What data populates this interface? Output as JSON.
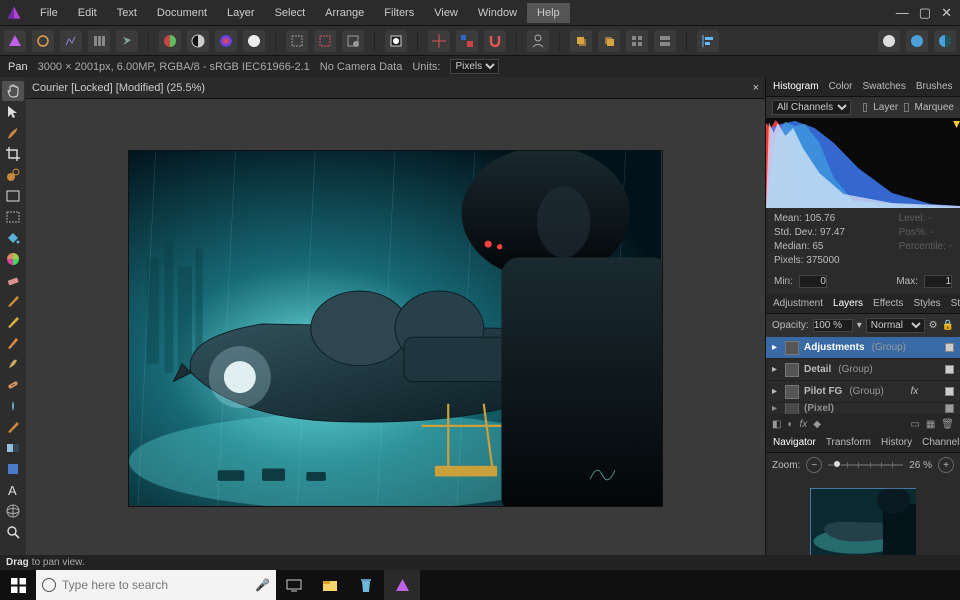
{
  "window": {
    "min": "—",
    "max": "▢",
    "close": "✕"
  },
  "menus": [
    "File",
    "Edit",
    "Text",
    "Document",
    "Layer",
    "Select",
    "Arrange",
    "Filters",
    "View",
    "Window",
    "Help"
  ],
  "menu_active": 10,
  "context": {
    "tool": "Pan",
    "docinfo": "3000 × 2001px, 6.00MP, RGBA/8 - sRGB IEC61966-2.1",
    "camera": "No Camera Data",
    "units_label": "Units:",
    "units_value": "Pixels"
  },
  "lefttools": [
    "hand-icon",
    "arrow-icon",
    "brush-icon",
    "crop-icon",
    "clone-icon",
    "marquee-icon",
    "dotted-marquee-icon",
    "flood-icon",
    "color-wheel-icon",
    "eraser-icon",
    "paintbrush-icon",
    "liquify-icon",
    "pencil-icon",
    "smudge-icon",
    "healing-icon",
    "dodge-icon",
    "paint-bucket-icon",
    "gradient-icon",
    "shape-icon",
    "text-a-icon",
    "mesh-icon",
    "zoom-icon"
  ],
  "doctab": {
    "title": "Courier [Locked] [Modified] (25.5%)",
    "close": "×"
  },
  "hist_tabs": [
    "Histogram",
    "Color",
    "Swatches",
    "Brushes"
  ],
  "hist_active": 0,
  "hist": {
    "channels": "All Channels",
    "layer_label": "Layer",
    "marquee_label": "Marquee",
    "mean_label": "Mean:",
    "mean": "105.76",
    "std_label": "Std. Dev.:",
    "std": "97.47",
    "median_label": "Median:",
    "median": "65",
    "pixels_label": "Pixels:",
    "pixels": "375000",
    "level_label": "Level:",
    "level": "-",
    "poss_label": "Pos%:",
    "poss": "-",
    "percent_label": "Percentile:",
    "percent": "-",
    "min_label": "Min:",
    "min": "0",
    "max_label": "Max:",
    "max": "1"
  },
  "layers_tabs": [
    "Adjustment",
    "Layers",
    "Effects",
    "Styles",
    "Stock"
  ],
  "layers_active": 1,
  "layers_opts": {
    "opacity_label": "Opacity:",
    "opacity": "100 %",
    "blend": "Normal"
  },
  "layers": [
    {
      "name": "Adjustments",
      "grp": "(Group)",
      "sel": true,
      "fx": false
    },
    {
      "name": "Detail",
      "grp": "(Group)",
      "sel": false,
      "fx": false
    },
    {
      "name": "Pilot FG",
      "grp": "(Group)",
      "sel": false,
      "fx": true
    },
    {
      "name": "(Pixel)",
      "grp": "",
      "sel": false,
      "fx": false,
      "trunc": true
    }
  ],
  "nav_tabs": [
    "Navigator",
    "Transform",
    "History",
    "Channels"
  ],
  "nav_active": 0,
  "nav": {
    "zoom_label": "Zoom:",
    "zoom": "26 %"
  },
  "status": {
    "bold": "Drag",
    "rest": "to pan view."
  },
  "taskbar": {
    "search": "Type here to search"
  }
}
